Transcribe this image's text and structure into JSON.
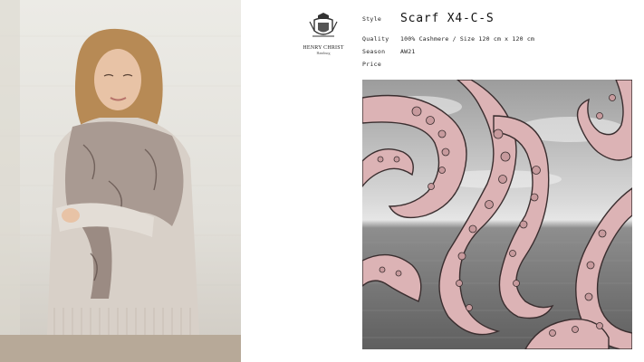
{
  "brand": {
    "name": "HENRY CHRIST",
    "city": "Hamburg"
  },
  "specs": {
    "style_label": "Style",
    "style_value": "Scarf X4-C-S",
    "quality_label": "Quality",
    "quality_value": "100% Cashmere / Size 120 cm x 120 cm",
    "season_label": "Season",
    "season_value": "AW21",
    "price_label": "Price",
    "price_value": ""
  },
  "colors": {
    "tentacle_pink": "#dcb3b5",
    "tentacle_outline": "#3a2e2f",
    "sea_grey": "#8e8e8e",
    "sky_grey": "#cfcfcf"
  },
  "images": {
    "model_photo": "model-wearing-scarf",
    "scarf_print": "octopus-tentacles-over-sea"
  }
}
